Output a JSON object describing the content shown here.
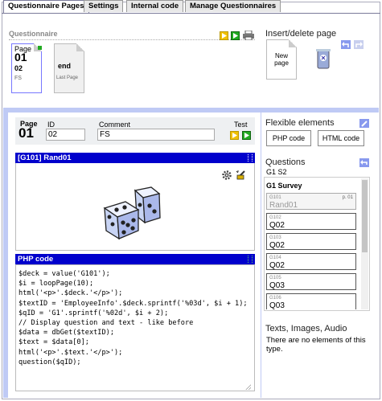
{
  "tabs": [
    "Questionnaire Pages",
    "Settings",
    "Internal code",
    "Manage Questionnaires"
  ],
  "questionnaire_section": {
    "title": "Questionnaire",
    "pages": [
      {
        "label": "Page",
        "num": "01",
        "sub": "02",
        "filter": "FS"
      },
      {
        "label": "end",
        "num": "",
        "sub": "Last Page",
        "filter": ""
      }
    ]
  },
  "insert_delete": {
    "title": "Insert/delete page",
    "new_page_line1": "New",
    "new_page_line2": "page"
  },
  "page_header": {
    "page_label": "Page",
    "page_num": "01",
    "id_label": "ID",
    "id_value": "02",
    "comment_label": "Comment",
    "comment_value": "FS",
    "test_label": "Test"
  },
  "question_block": {
    "title": "[G101] Rand01"
  },
  "php_block": {
    "title": "PHP code",
    "lines": [
      "$deck = value('G101');",
      "$i = loopPage(10);",
      "html('<p>'.$deck.'</p>');",
      "$textID = 'EmployeeInfo'.$deck.sprintf('%03d', $i + 1);",
      "$qID = 'G1'.sprintf('%02d', $i + 2);",
      "// Display question and text - like before",
      "$data = dbGet($textID);",
      "$text = $data[0];",
      "html('<p>'.$text.'</p>');",
      "question($qID);"
    ]
  },
  "flexible": {
    "title": "Flexible elements",
    "php_btn": "PHP code",
    "html_btn": "HTML code"
  },
  "questions": {
    "title": "Questions",
    "filter": "G1 S2",
    "survey": "G1 Survey",
    "items": [
      {
        "id": "G101",
        "name": "Rand01",
        "page": "p. 01",
        "disabled": true
      },
      {
        "id": "G102",
        "name": "Q02",
        "page": ""
      },
      {
        "id": "G103",
        "name": "Q02",
        "page": ""
      },
      {
        "id": "G104",
        "name": "Q02",
        "page": ""
      },
      {
        "id": "G105",
        "name": "Q03",
        "page": ""
      },
      {
        "id": "G106",
        "name": "Q03",
        "page": ""
      }
    ]
  },
  "texts": {
    "title": "Texts, Images, Audio",
    "body": "There are no elements of this type."
  },
  "colors": {
    "accent_blue": "#0000cc",
    "bar": "#bfcaf5",
    "play_yellow": "#f0c000",
    "play_green": "#22aa22"
  }
}
